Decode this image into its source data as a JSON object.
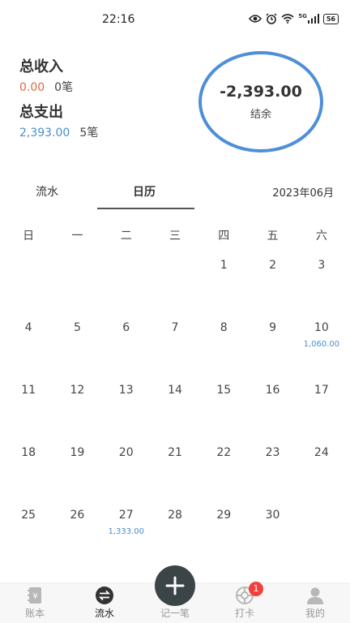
{
  "status_bar": {
    "time": "22:16",
    "network": "5G",
    "battery": "56"
  },
  "summary": {
    "income_title": "总收入",
    "income_amount": "0.00",
    "income_count": "0笔",
    "expense_title": "总支出",
    "expense_amount": "2,393.00",
    "expense_count": "5笔",
    "balance_amount": "-2,393.00",
    "balance_label": "结余",
    "colors": {
      "income": "#e0683f",
      "expense": "#4a8fc9",
      "ring": "#4e8fd7"
    }
  },
  "tabs": {
    "flow": "流水",
    "calendar": "日历",
    "active": "calendar"
  },
  "month_picker": "2023年06月",
  "calendar": {
    "weekdays": [
      "日",
      "一",
      "二",
      "三",
      "四",
      "五",
      "六"
    ],
    "weeks": [
      [
        {
          "d": ""
        },
        {
          "d": ""
        },
        {
          "d": ""
        },
        {
          "d": ""
        },
        {
          "d": "1"
        },
        {
          "d": "2"
        },
        {
          "d": "3"
        }
      ],
      [
        {
          "d": "4"
        },
        {
          "d": "5"
        },
        {
          "d": "6"
        },
        {
          "d": "7"
        },
        {
          "d": "8"
        },
        {
          "d": "9"
        },
        {
          "d": "10",
          "amt": "1,060.00"
        }
      ],
      [
        {
          "d": "11"
        },
        {
          "d": "12"
        },
        {
          "d": "13"
        },
        {
          "d": "14"
        },
        {
          "d": "15"
        },
        {
          "d": "16"
        },
        {
          "d": "17"
        }
      ],
      [
        {
          "d": "18"
        },
        {
          "d": "19"
        },
        {
          "d": "20"
        },
        {
          "d": "21"
        },
        {
          "d": "22"
        },
        {
          "d": "23"
        },
        {
          "d": "24"
        }
      ],
      [
        {
          "d": "25"
        },
        {
          "d": "26"
        },
        {
          "d": "27",
          "amt": "1,333.00"
        },
        {
          "d": "28"
        },
        {
          "d": "29"
        },
        {
          "d": "30"
        },
        {
          "d": ""
        }
      ]
    ]
  },
  "bottom_nav": {
    "ledger": "账本",
    "flow": "流水",
    "add": "记一笔",
    "checkin": "打卡",
    "checkin_badge": "1",
    "mine": "我的",
    "active": "flow"
  }
}
